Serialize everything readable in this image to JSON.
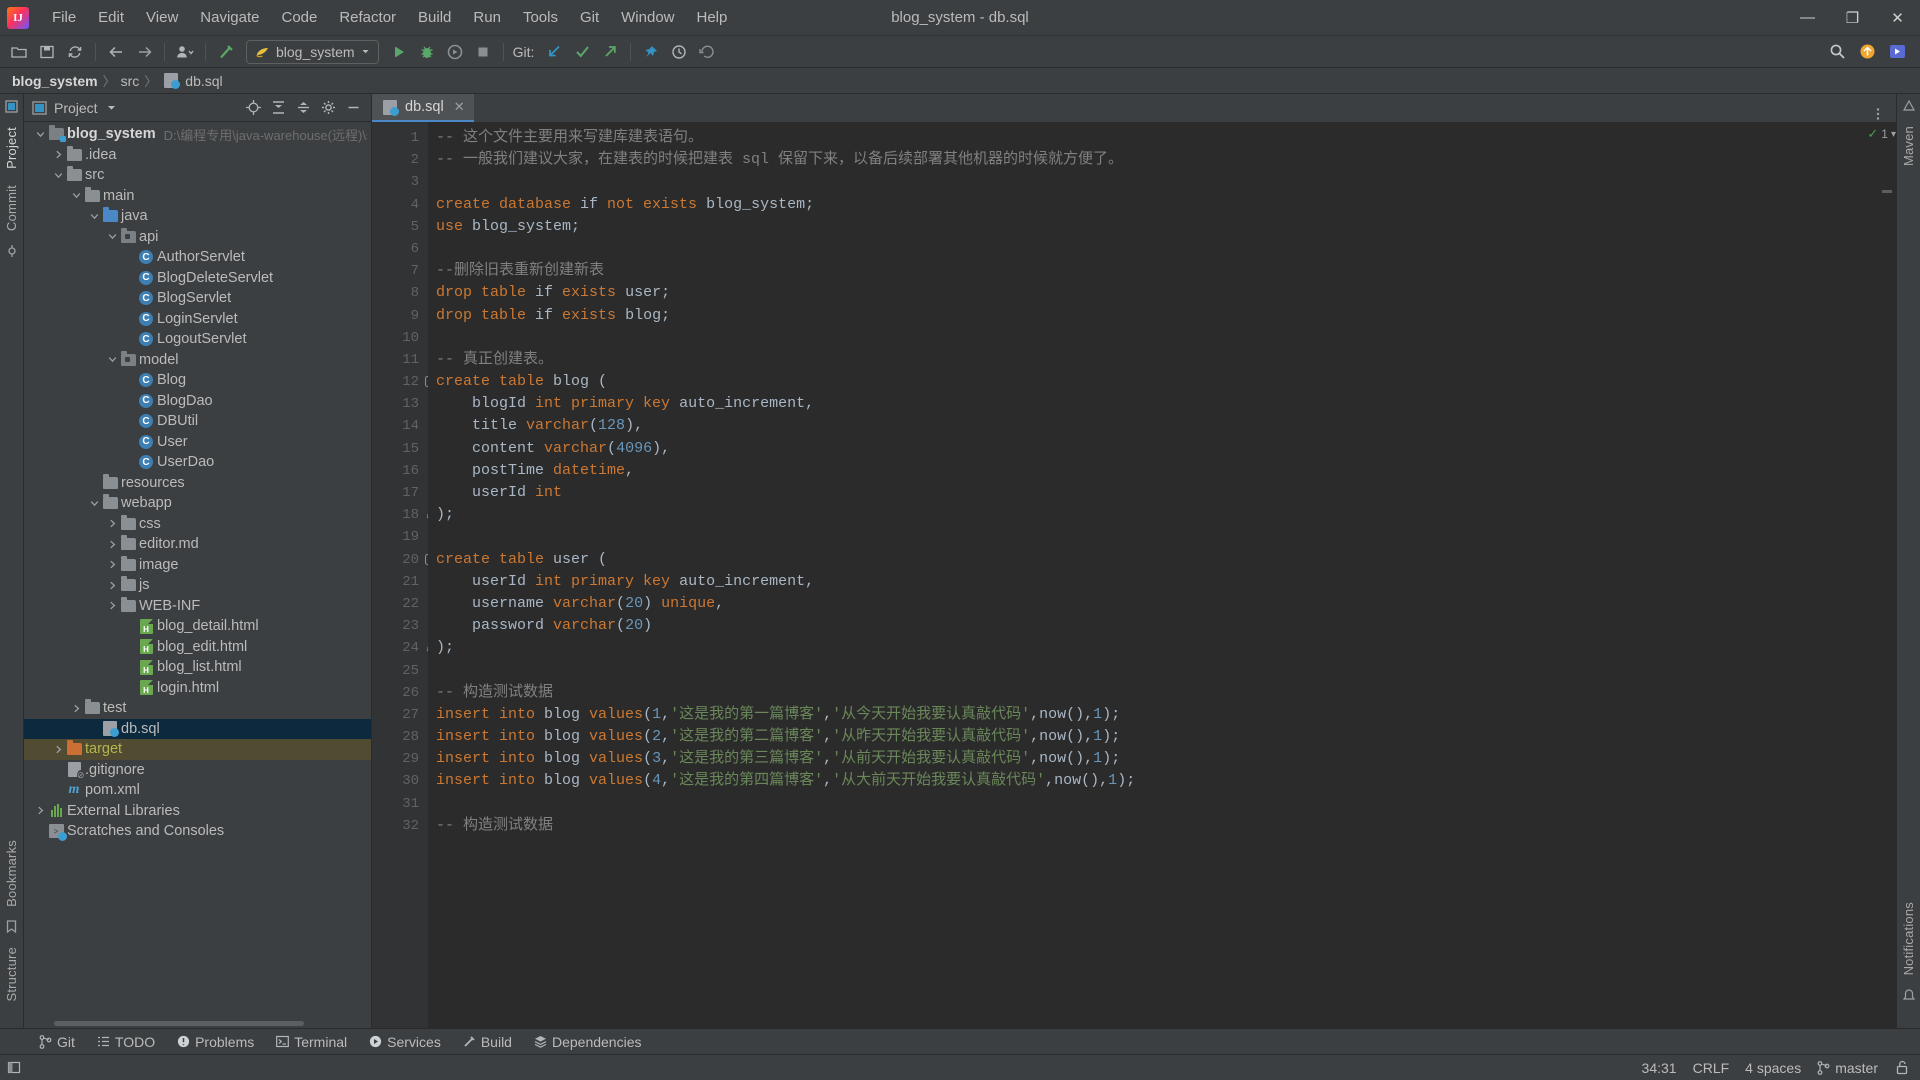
{
  "window": {
    "title": "blog_system - db.sql",
    "logo_text": "IJ",
    "controls": {
      "minimize": "—",
      "maximize": "❐",
      "close": "✕"
    }
  },
  "menu": {
    "items": [
      {
        "label": "File"
      },
      {
        "label": "Edit"
      },
      {
        "label": "View"
      },
      {
        "label": "Navigate"
      },
      {
        "label": "Code"
      },
      {
        "label": "Refactor"
      },
      {
        "label": "Build"
      },
      {
        "label": "Run"
      },
      {
        "label": "Tools"
      },
      {
        "label": "Git"
      },
      {
        "label": "Window"
      },
      {
        "label": "Help"
      }
    ]
  },
  "toolbar": {
    "run_config": "blog_system",
    "git_label": "Git:",
    "icons": [
      "open-folder-icon",
      "save-all-icon",
      "sync-icon",
      "back-arrow-icon",
      "forward-arrow-icon",
      "profile-icon",
      "build-hammer-icon"
    ],
    "run_icons": [
      "run-icon",
      "debug-icon",
      "run-coverage-icon",
      "stop-icon"
    ],
    "git_icons": [
      "git-update-icon",
      "git-commit-icon",
      "git-push-icon"
    ],
    "right_icons": [
      "search-everywhere-icon",
      "plugin-update-icon",
      "ide-run-icon"
    ]
  },
  "breadcrumb": {
    "items": [
      {
        "label": "blog_system",
        "bold": true
      },
      {
        "label": "src",
        "bold": false
      },
      {
        "label": "db.sql",
        "bold": false
      }
    ],
    "separator": "〉"
  },
  "project_panel": {
    "title": "Project",
    "header_icons": [
      "locate-icon",
      "expand-all-icon",
      "collapse-all-icon",
      "settings-gear-icon",
      "hide-icon"
    ],
    "tree": [
      {
        "depth": 0,
        "arrow": "down",
        "icon": "module-folder-icon",
        "label": "blog_system",
        "bold": true,
        "path": "D:\\编程专用\\java-warehouse(远程)\\serv",
        "state": "normal"
      },
      {
        "depth": 1,
        "arrow": "right",
        "icon": "folder-icon",
        "label": ".idea",
        "state": "normal"
      },
      {
        "depth": 1,
        "arrow": "down",
        "icon": "folder-icon",
        "label": "src",
        "state": "normal"
      },
      {
        "depth": 2,
        "arrow": "down",
        "icon": "folder-icon",
        "label": "main",
        "state": "normal"
      },
      {
        "depth": 3,
        "arrow": "down",
        "icon": "source-folder-icon",
        "label": "java",
        "state": "normal"
      },
      {
        "depth": 4,
        "arrow": "down",
        "icon": "package-icon",
        "label": "api",
        "state": "normal"
      },
      {
        "depth": 5,
        "arrow": "none",
        "icon": "java-class-icon",
        "label": "AuthorServlet",
        "state": "normal"
      },
      {
        "depth": 5,
        "arrow": "none",
        "icon": "java-class-icon",
        "label": "BlogDeleteServlet",
        "state": "normal"
      },
      {
        "depth": 5,
        "arrow": "none",
        "icon": "java-class-icon",
        "label": "BlogServlet",
        "state": "normal"
      },
      {
        "depth": 5,
        "arrow": "none",
        "icon": "java-class-icon",
        "label": "LoginServlet",
        "state": "normal"
      },
      {
        "depth": 5,
        "arrow": "none",
        "icon": "java-class-icon",
        "label": "LogoutServlet",
        "state": "normal"
      },
      {
        "depth": 4,
        "arrow": "down",
        "icon": "package-icon",
        "label": "model",
        "state": "normal"
      },
      {
        "depth": 5,
        "arrow": "none",
        "icon": "java-class-icon",
        "label": "Blog",
        "state": "normal"
      },
      {
        "depth": 5,
        "arrow": "none",
        "icon": "java-class-icon",
        "label": "BlogDao",
        "state": "normal"
      },
      {
        "depth": 5,
        "arrow": "none",
        "icon": "java-class-icon",
        "label": "DBUtil",
        "state": "normal"
      },
      {
        "depth": 5,
        "arrow": "none",
        "icon": "java-class-icon",
        "label": "User",
        "state": "normal"
      },
      {
        "depth": 5,
        "arrow": "none",
        "icon": "java-class-icon",
        "label": "UserDao",
        "state": "normal"
      },
      {
        "depth": 3,
        "arrow": "none",
        "icon": "folder-icon",
        "label": "resources",
        "state": "normal"
      },
      {
        "depth": 3,
        "arrow": "down",
        "icon": "folder-icon",
        "label": "webapp",
        "state": "normal"
      },
      {
        "depth": 4,
        "arrow": "right",
        "icon": "folder-icon",
        "label": "css",
        "state": "normal"
      },
      {
        "depth": 4,
        "arrow": "right",
        "icon": "folder-icon",
        "label": "editor.md",
        "state": "normal"
      },
      {
        "depth": 4,
        "arrow": "right",
        "icon": "folder-icon",
        "label": "image",
        "state": "normal"
      },
      {
        "depth": 4,
        "arrow": "right",
        "icon": "folder-icon",
        "label": "js",
        "state": "normal"
      },
      {
        "depth": 4,
        "arrow": "right",
        "icon": "folder-icon",
        "label": "WEB-INF",
        "state": "normal"
      },
      {
        "depth": 5,
        "arrow": "none",
        "icon": "html-file-icon",
        "label": "blog_detail.html",
        "state": "normal"
      },
      {
        "depth": 5,
        "arrow": "none",
        "icon": "html-file-icon",
        "label": "blog_edit.html",
        "state": "normal"
      },
      {
        "depth": 5,
        "arrow": "none",
        "icon": "html-file-icon",
        "label": "blog_list.html",
        "state": "normal"
      },
      {
        "depth": 5,
        "arrow": "none",
        "icon": "html-file-icon",
        "label": "login.html",
        "state": "normal"
      },
      {
        "depth": 2,
        "arrow": "right",
        "icon": "folder-icon",
        "label": "test",
        "state": "normal"
      },
      {
        "depth": 3,
        "arrow": "none",
        "icon": "sql-file-icon",
        "label": "db.sql",
        "state": "selected"
      },
      {
        "depth": 1,
        "arrow": "right",
        "icon": "target-folder-icon",
        "label": "target",
        "state": "marked"
      },
      {
        "depth": 1,
        "arrow": "none",
        "icon": "gitignore-file-icon",
        "label": ".gitignore",
        "state": "normal"
      },
      {
        "depth": 1,
        "arrow": "none",
        "icon": "maven-file-icon",
        "label": "pom.xml",
        "state": "normal"
      },
      {
        "depth": 0,
        "arrow": "right",
        "icon": "external-libraries-icon",
        "label": "External Libraries",
        "state": "normal"
      },
      {
        "depth": 0,
        "arrow": "none",
        "icon": "scratches-icon",
        "label": "Scratches and Consoles",
        "state": "normal"
      }
    ]
  },
  "left_strip": {
    "tabs": [
      {
        "label": "Project",
        "active": true
      },
      {
        "label": "Commit",
        "active": false
      },
      {
        "label": "Bookmarks",
        "active": false
      },
      {
        "label": "Structure",
        "active": false
      }
    ]
  },
  "right_strip": {
    "tabs": [
      {
        "label": "Maven",
        "active": false
      },
      {
        "label": "Notifications",
        "active": false
      }
    ]
  },
  "editor": {
    "tab": {
      "label": "db.sql",
      "icon": "sql-file-icon",
      "close": "✕"
    },
    "inspection": {
      "status": "ok",
      "count": "1",
      "mark": "✓"
    },
    "first_line": 1,
    "lines": [
      {
        "n": 1,
        "fold": "",
        "tokens": [
          {
            "t": "-- ",
            "c": "cm"
          },
          {
            "t": "这个文件主要用来写建库建表语句。",
            "c": "cm"
          }
        ]
      },
      {
        "n": 2,
        "fold": "",
        "tokens": [
          {
            "t": "-- ",
            "c": "cm"
          },
          {
            "t": "一般我们建议大家，在建表的时候把建表 sql 保留下来，以备后续部署其他机器的时候就方便了。",
            "c": "cm"
          }
        ]
      },
      {
        "n": 3,
        "fold": "",
        "tokens": []
      },
      {
        "n": 4,
        "fold": "",
        "tokens": [
          {
            "t": "create database ",
            "c": "kw"
          },
          {
            "t": "if ",
            "c": "pl"
          },
          {
            "t": "not exists ",
            "c": "kw"
          },
          {
            "t": "blog_system;",
            "c": "pl"
          }
        ]
      },
      {
        "n": 5,
        "fold": "",
        "tokens": [
          {
            "t": "use ",
            "c": "kw"
          },
          {
            "t": "blog_system;",
            "c": "pl"
          }
        ]
      },
      {
        "n": 6,
        "fold": "",
        "tokens": []
      },
      {
        "n": 7,
        "fold": "",
        "tokens": [
          {
            "t": "--删除旧表重新创建新表",
            "c": "cm"
          }
        ]
      },
      {
        "n": 8,
        "fold": "",
        "tokens": [
          {
            "t": "drop table ",
            "c": "kw"
          },
          {
            "t": "if ",
            "c": "pl"
          },
          {
            "t": "exists ",
            "c": "kw"
          },
          {
            "t": "user;",
            "c": "pl"
          }
        ]
      },
      {
        "n": 9,
        "fold": "",
        "tokens": [
          {
            "t": "drop table ",
            "c": "kw"
          },
          {
            "t": "if ",
            "c": "pl"
          },
          {
            "t": "exists ",
            "c": "kw"
          },
          {
            "t": "blog;",
            "c": "pl"
          }
        ]
      },
      {
        "n": 10,
        "fold": "",
        "tokens": []
      },
      {
        "n": 11,
        "fold": "",
        "tokens": [
          {
            "t": "-- ",
            "c": "cm"
          },
          {
            "t": "真正创建表。",
            "c": "cm"
          }
        ]
      },
      {
        "n": 12,
        "fold": "open",
        "tokens": [
          {
            "t": "create table ",
            "c": "kw"
          },
          {
            "t": "blog (",
            "c": "pl"
          }
        ]
      },
      {
        "n": 13,
        "fold": "",
        "tokens": [
          {
            "t": "    blogId ",
            "c": "pl"
          },
          {
            "t": "int primary key ",
            "c": "kw"
          },
          {
            "t": "auto_increment,",
            "c": "pl"
          }
        ]
      },
      {
        "n": 14,
        "fold": "",
        "tokens": [
          {
            "t": "    title ",
            "c": "pl"
          },
          {
            "t": "varchar",
            "c": "kw"
          },
          {
            "t": "(",
            "c": "pl"
          },
          {
            "t": "128",
            "c": "num"
          },
          {
            "t": "),",
            "c": "pl"
          }
        ]
      },
      {
        "n": 15,
        "fold": "",
        "tokens": [
          {
            "t": "    content ",
            "c": "pl"
          },
          {
            "t": "varchar",
            "c": "kw"
          },
          {
            "t": "(",
            "c": "pl"
          },
          {
            "t": "4096",
            "c": "num"
          },
          {
            "t": "),",
            "c": "pl"
          }
        ]
      },
      {
        "n": 16,
        "fold": "",
        "tokens": [
          {
            "t": "    postTime ",
            "c": "pl"
          },
          {
            "t": "datetime",
            "c": "kw"
          },
          {
            "t": ",",
            "c": "pl"
          }
        ]
      },
      {
        "n": 17,
        "fold": "",
        "tokens": [
          {
            "t": "    userId ",
            "c": "pl"
          },
          {
            "t": "int",
            "c": "kw"
          }
        ]
      },
      {
        "n": 18,
        "fold": "close",
        "tokens": [
          {
            "t": ");",
            "c": "pl"
          }
        ]
      },
      {
        "n": 19,
        "fold": "",
        "tokens": []
      },
      {
        "n": 20,
        "fold": "open",
        "tokens": [
          {
            "t": "create table ",
            "c": "kw"
          },
          {
            "t": "user (",
            "c": "pl"
          }
        ]
      },
      {
        "n": 21,
        "fold": "",
        "tokens": [
          {
            "t": "    userId ",
            "c": "pl"
          },
          {
            "t": "int primary key ",
            "c": "kw"
          },
          {
            "t": "auto_increment,",
            "c": "pl"
          }
        ]
      },
      {
        "n": 22,
        "fold": "",
        "tokens": [
          {
            "t": "    username ",
            "c": "pl"
          },
          {
            "t": "varchar",
            "c": "kw"
          },
          {
            "t": "(",
            "c": "pl"
          },
          {
            "t": "20",
            "c": "num"
          },
          {
            "t": ") ",
            "c": "pl"
          },
          {
            "t": "unique",
            "c": "kw"
          },
          {
            "t": ",",
            "c": "pl"
          }
        ]
      },
      {
        "n": 23,
        "fold": "",
        "tokens": [
          {
            "t": "    password ",
            "c": "pl"
          },
          {
            "t": "varchar",
            "c": "kw"
          },
          {
            "t": "(",
            "c": "pl"
          },
          {
            "t": "20",
            "c": "num"
          },
          {
            "t": ")",
            "c": "pl"
          }
        ]
      },
      {
        "n": 24,
        "fold": "close",
        "tokens": [
          {
            "t": ");",
            "c": "pl"
          }
        ]
      },
      {
        "n": 25,
        "fold": "",
        "tokens": []
      },
      {
        "n": 26,
        "fold": "",
        "tokens": [
          {
            "t": "-- ",
            "c": "cm"
          },
          {
            "t": "构造测试数据",
            "c": "cm"
          }
        ]
      },
      {
        "n": 27,
        "fold": "",
        "tokens": [
          {
            "t": "insert into ",
            "c": "kw"
          },
          {
            "t": "blog ",
            "c": "pl"
          },
          {
            "t": "values",
            "c": "kw"
          },
          {
            "t": "(",
            "c": "pl"
          },
          {
            "t": "1",
            "c": "num"
          },
          {
            "t": ",",
            "c": "pl"
          },
          {
            "t": "'这是我的第一篇博客'",
            "c": "str"
          },
          {
            "t": ",",
            "c": "pl"
          },
          {
            "t": "'从今天开始我要认真敲代码'",
            "c": "str"
          },
          {
            "t": ",now(),",
            "c": "pl"
          },
          {
            "t": "1",
            "c": "num"
          },
          {
            "t": ");",
            "c": "pl"
          }
        ]
      },
      {
        "n": 28,
        "fold": "",
        "tokens": [
          {
            "t": "insert into ",
            "c": "kw"
          },
          {
            "t": "blog ",
            "c": "pl"
          },
          {
            "t": "values",
            "c": "kw"
          },
          {
            "t": "(",
            "c": "pl"
          },
          {
            "t": "2",
            "c": "num"
          },
          {
            "t": ",",
            "c": "pl"
          },
          {
            "t": "'这是我的第二篇博客'",
            "c": "str"
          },
          {
            "t": ",",
            "c": "pl"
          },
          {
            "t": "'从昨天开始我要认真敲代码'",
            "c": "str"
          },
          {
            "t": ",now(),",
            "c": "pl"
          },
          {
            "t": "1",
            "c": "num"
          },
          {
            "t": ");",
            "c": "pl"
          }
        ]
      },
      {
        "n": 29,
        "fold": "",
        "tokens": [
          {
            "t": "insert into ",
            "c": "kw"
          },
          {
            "t": "blog ",
            "c": "pl"
          },
          {
            "t": "values",
            "c": "kw"
          },
          {
            "t": "(",
            "c": "pl"
          },
          {
            "t": "3",
            "c": "num"
          },
          {
            "t": ",",
            "c": "pl"
          },
          {
            "t": "'这是我的第三篇博客'",
            "c": "str"
          },
          {
            "t": ",",
            "c": "pl"
          },
          {
            "t": "'从前天开始我要认真敲代码'",
            "c": "str"
          },
          {
            "t": ",now(),",
            "c": "pl"
          },
          {
            "t": "1",
            "c": "num"
          },
          {
            "t": ");",
            "c": "pl"
          }
        ]
      },
      {
        "n": 30,
        "fold": "",
        "tokens": [
          {
            "t": "insert into ",
            "c": "kw"
          },
          {
            "t": "blog ",
            "c": "pl"
          },
          {
            "t": "values",
            "c": "kw"
          },
          {
            "t": "(",
            "c": "pl"
          },
          {
            "t": "4",
            "c": "num"
          },
          {
            "t": ",",
            "c": "pl"
          },
          {
            "t": "'这是我的第四篇博客'",
            "c": "str"
          },
          {
            "t": ",",
            "c": "pl"
          },
          {
            "t": "'从大前天开始我要认真敲代码'",
            "c": "str"
          },
          {
            "t": ",now(),",
            "c": "pl"
          },
          {
            "t": "1",
            "c": "num"
          },
          {
            "t": ");",
            "c": "pl"
          }
        ]
      },
      {
        "n": 31,
        "fold": "",
        "tokens": []
      },
      {
        "n": 32,
        "fold": "",
        "tokens": [
          {
            "t": "-- ",
            "c": "cm"
          },
          {
            "t": "构造测试数据",
            "c": "cm"
          }
        ]
      }
    ]
  },
  "tool_windows": {
    "items": [
      {
        "label": "Git",
        "icon": "git-branch-icon"
      },
      {
        "label": "TODO",
        "icon": "todo-list-icon"
      },
      {
        "label": "Problems",
        "icon": "problems-icon"
      },
      {
        "label": "Terminal",
        "icon": "terminal-icon"
      },
      {
        "label": "Services",
        "icon": "services-icon"
      },
      {
        "label": "Build",
        "icon": "build-hammer-icon"
      },
      {
        "label": "Dependencies",
        "icon": "dependencies-icon"
      }
    ]
  },
  "status_bar": {
    "left_icon": "show-tool-windows-icon",
    "caret_position": "34:31",
    "line_separator": "CRLF",
    "indent": "4 spaces",
    "branch": "master",
    "branch_icon": "git-branch-icon",
    "lock_icon": "unlocked-icon"
  },
  "colors": {
    "accent": "#4a88c7",
    "selection": "#0d293e",
    "marked": "#514b32",
    "keyword": "#cc7832",
    "string": "#6a8759",
    "number": "#6897bb",
    "comment": "#808080",
    "editor_bg": "#2b2b2b",
    "panel_bg": "#3c3f41"
  }
}
